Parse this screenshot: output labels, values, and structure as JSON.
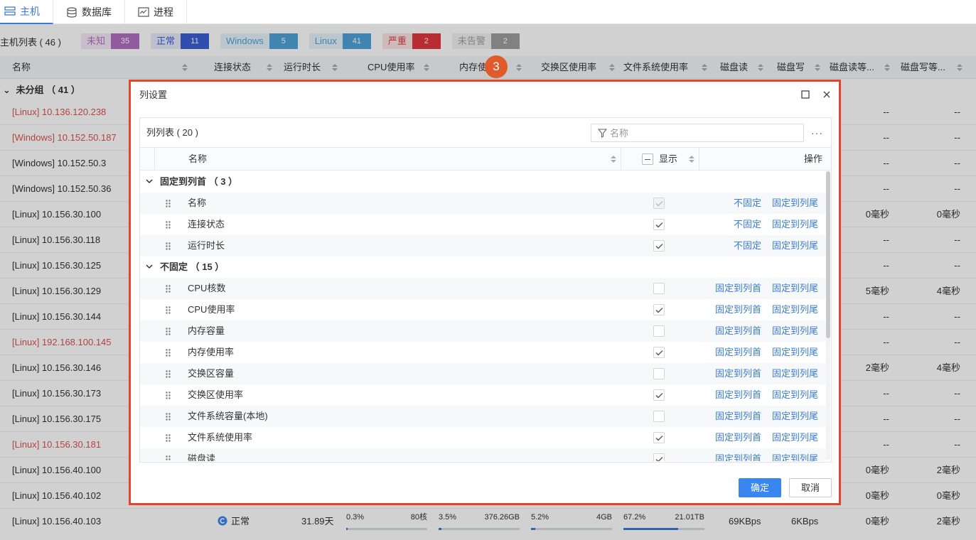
{
  "tabs": [
    {
      "label": "主机",
      "active": true,
      "icon": "host-icon"
    },
    {
      "label": "数据库",
      "active": false,
      "icon": "database-icon"
    },
    {
      "label": "进程",
      "active": false,
      "icon": "process-icon"
    }
  ],
  "summary": {
    "title": "主机列表 ( 46 )",
    "tags": [
      {
        "label": "未知",
        "count": "35",
        "color": "#b36fc4",
        "bg": "#f4e8f7"
      },
      {
        "label": "正常",
        "count": "11",
        "color": "#3c5ed3",
        "bg": "#e6ebfb"
      },
      {
        "label": "Windows",
        "count": "5",
        "color": "#4fa3d9",
        "bg": "#e5f2fb"
      },
      {
        "label": "Linux",
        "count": "41",
        "color": "#4fa3d9",
        "bg": "#e5f2fb"
      },
      {
        "label": "严重",
        "count": "2",
        "color": "#e0383e",
        "bg": "#fbe5e6"
      },
      {
        "label": "未告警",
        "count": "2",
        "color": "#9e9e9e",
        "bg": "#f1f1f1"
      }
    ]
  },
  "table_headers": [
    "名称",
    "连接状态",
    "运行时长",
    "CPU使用率",
    "内存使",
    "交换区使用率",
    "文件系统使用率",
    "磁盘读",
    "磁盘写",
    "磁盘读等...",
    "磁盘写等..."
  ],
  "group_label": "未分组 （ 41 ）",
  "hosts": [
    {
      "name": "[Linux] 10.136.120.238",
      "error": true,
      "c1": "--",
      "c2": "--"
    },
    {
      "name": "[Windows] 10.152.50.187",
      "error": true,
      "c1": "--",
      "c2": "--"
    },
    {
      "name": "[Windows] 10.152.50.3",
      "error": false,
      "c1": "--",
      "c2": "--"
    },
    {
      "name": "[Windows] 10.152.50.36",
      "error": false,
      "c1": "--",
      "c2": "--"
    },
    {
      "name": "[Linux] 10.156.30.100",
      "error": false,
      "c1": "0毫秒",
      "c2": "0毫秒"
    },
    {
      "name": "[Linux] 10.156.30.118",
      "error": false,
      "c1": "--",
      "c2": "--"
    },
    {
      "name": "[Linux] 10.156.30.125",
      "error": false,
      "c1": "--",
      "c2": "--"
    },
    {
      "name": "[Linux] 10.156.30.129",
      "error": false,
      "c1": "5毫秒",
      "c2": "4毫秒"
    },
    {
      "name": "[Linux] 10.156.30.144",
      "error": false,
      "c1": "--",
      "c2": "--"
    },
    {
      "name": "[Linux] 192.168.100.145",
      "error": true,
      "c1": "--",
      "c2": "--"
    },
    {
      "name": "[Linux] 10.156.30.146",
      "error": false,
      "c1": "2毫秒",
      "c2": "4毫秒"
    },
    {
      "name": "[Linux] 10.156.30.173",
      "error": false,
      "c1": "--",
      "c2": "--"
    },
    {
      "name": "[Linux] 10.156.30.175",
      "error": false,
      "c1": "--",
      "c2": "--"
    },
    {
      "name": "[Linux] 10.156.30.181",
      "error": true,
      "c1": "--",
      "c2": "--"
    },
    {
      "name": "[Linux] 10.156.40.100",
      "error": false,
      "c1": "0毫秒",
      "c2": "2毫秒"
    },
    {
      "name": "[Linux] 10.156.40.102",
      "error": false,
      "c1": "0毫秒",
      "c2": "0毫秒"
    }
  ],
  "last_row": {
    "name": "[Linux] 10.156.40.103",
    "status": "正常",
    "uptime": "31.89天",
    "cpu_pct": "0.3%",
    "cpu_total": "80核",
    "cpu_fill": 0.003,
    "mem_pct": "3.5%",
    "mem_total": "376.26GB",
    "mem_fill": 0.035,
    "swap_pct": "5.2%",
    "swap_total": "4GB",
    "swap_fill": 0.052,
    "fs_pct": "67.2%",
    "fs_total": "21.01TB",
    "fs_fill": 0.672,
    "disk_read": "69KBps",
    "disk_write": "6KBps",
    "c1": "0毫秒",
    "c2": "2毫秒"
  },
  "step_badge": "3",
  "dialog": {
    "title": "列设置",
    "list_title": "列列表 ( 20 )",
    "filter_placeholder": "名称",
    "more_label": "···",
    "col_name": "名称",
    "col_show": "显示",
    "col_action": "操作",
    "groups": [
      {
        "label": "固定到列首 （ 3 ）",
        "items": [
          {
            "name": "名称",
            "checked": true,
            "disabled": true,
            "action1": "不固定",
            "action2": "固定到列尾"
          },
          {
            "name": "连接状态",
            "checked": true,
            "disabled": false,
            "action1": "不固定",
            "action2": "固定到列尾"
          },
          {
            "name": "运行时长",
            "checked": true,
            "disabled": false,
            "action1": "不固定",
            "action2": "固定到列尾"
          }
        ]
      },
      {
        "label": "不固定 （ 15 ）",
        "items": [
          {
            "name": "CPU核数",
            "checked": false,
            "disabled": false,
            "action1": "固定到列首",
            "action2": "固定到列尾"
          },
          {
            "name": "CPU使用率",
            "checked": true,
            "disabled": false,
            "action1": "固定到列首",
            "action2": "固定到列尾"
          },
          {
            "name": "内存容量",
            "checked": false,
            "disabled": false,
            "action1": "固定到列首",
            "action2": "固定到列尾"
          },
          {
            "name": "内存使用率",
            "checked": true,
            "disabled": false,
            "action1": "固定到列首",
            "action2": "固定到列尾"
          },
          {
            "name": "交换区容量",
            "checked": false,
            "disabled": false,
            "action1": "固定到列首",
            "action2": "固定到列尾"
          },
          {
            "name": "交换区使用率",
            "checked": true,
            "disabled": false,
            "action1": "固定到列首",
            "action2": "固定到列尾"
          },
          {
            "name": "文件系统容量(本地)",
            "checked": false,
            "disabled": false,
            "action1": "固定到列首",
            "action2": "固定到列尾"
          },
          {
            "name": "文件系统使用率",
            "checked": true,
            "disabled": false,
            "action1": "固定到列首",
            "action2": "固定到列尾"
          },
          {
            "name": "磁盘读",
            "checked": true,
            "disabled": false,
            "action1": "固定到列首",
            "action2": "固定到列尾"
          }
        ]
      }
    ],
    "ok_label": "确定",
    "cancel_label": "取消"
  }
}
